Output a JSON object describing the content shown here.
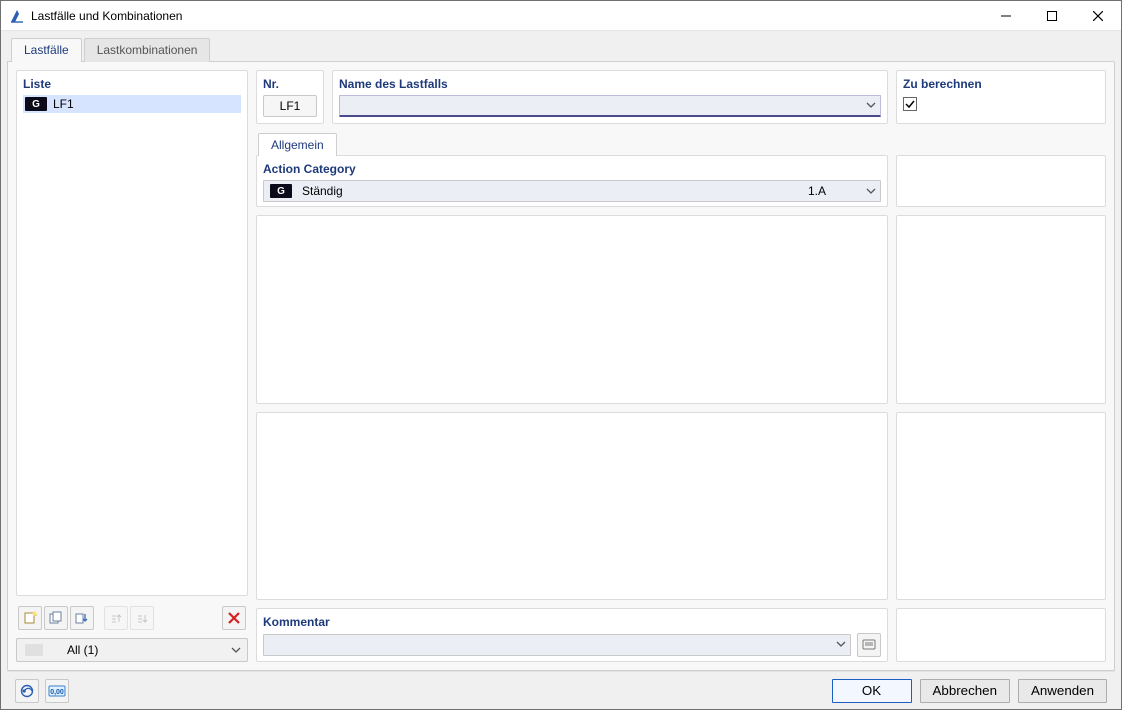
{
  "window": {
    "title": "Lastfälle und Kombinationen"
  },
  "tabs": {
    "lastfaelle": "Lastfälle",
    "lastkombinationen": "Lastkombinationen"
  },
  "left": {
    "liste_label": "Liste",
    "item_badge": "G",
    "item_label": "LF1",
    "filter_value": "All (1)"
  },
  "right": {
    "nr_label": "Nr.",
    "nr_value": "LF1",
    "name_label": "Name des Lastfalls",
    "name_value": "",
    "calc_label": "Zu berechnen",
    "calc_checked": true,
    "midtab_allgemein": "Allgemein",
    "action_category_label": "Action Category",
    "action_badge": "G",
    "action_name": "Ständig",
    "action_code": "1.A",
    "comment_label": "Kommentar",
    "comment_value": ""
  },
  "footer": {
    "ok": "OK",
    "cancel": "Abbrechen",
    "apply": "Anwenden"
  },
  "icons": {
    "new": "new-icon",
    "copy": "copy-icon",
    "sort": "sort-icon",
    "renumber1": "renumber-asc-icon",
    "renumber2": "renumber-desc-icon",
    "delete": "delete-icon",
    "help": "help-icon",
    "units": "units-icon",
    "comment_lib": "comment-library-icon"
  }
}
